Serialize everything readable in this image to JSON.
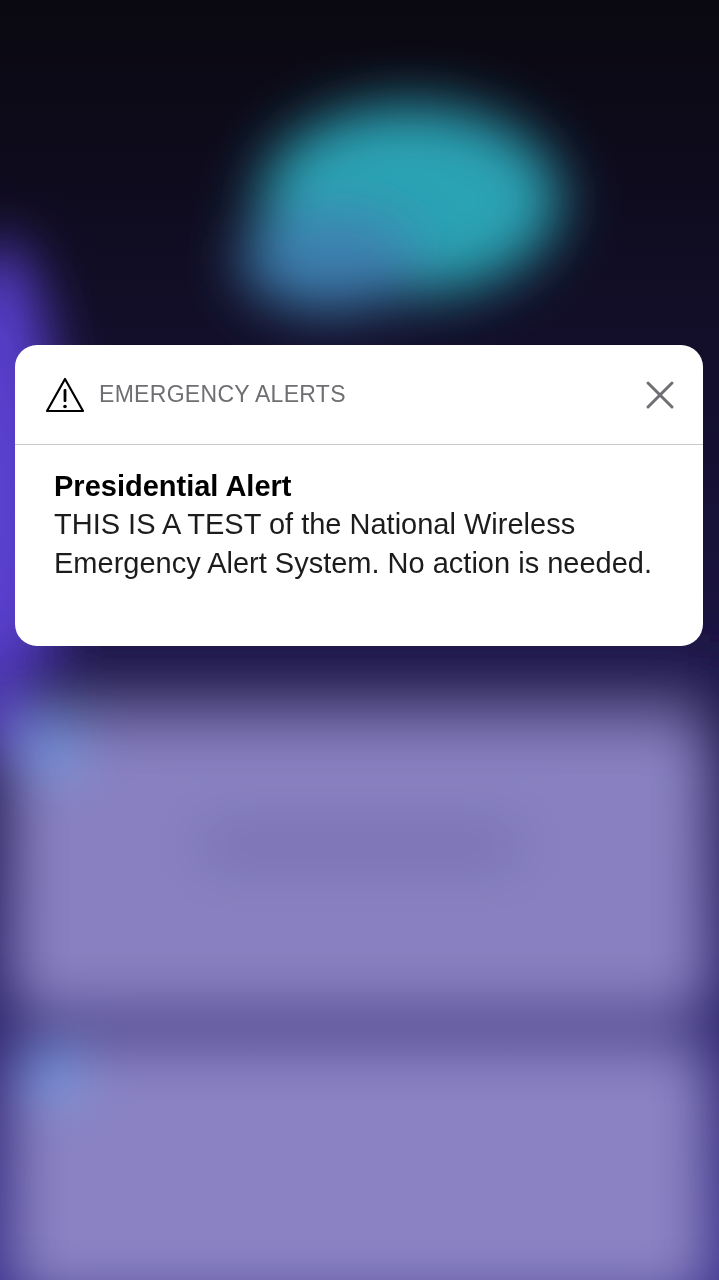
{
  "notification": {
    "app_name": "EMERGENCY ALERTS",
    "title": "Presidential Alert",
    "message": "THIS IS A TEST of the National Wireless Emergency Alert System. No action is needed."
  }
}
